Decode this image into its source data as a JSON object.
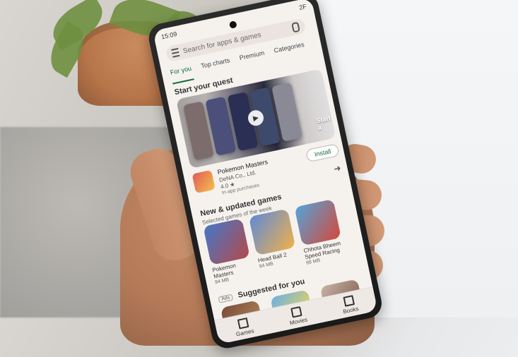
{
  "status": {
    "time": "15:09",
    "indicators": "2F"
  },
  "search": {
    "placeholder": "Search for apps & games"
  },
  "tabs": [
    "For you",
    "Top charts",
    "Premium",
    "Categories"
  ],
  "quest": {
    "title": "Start your quest",
    "right_label": "Start a"
  },
  "featured_app": {
    "name": "Pokemon Masters",
    "developer": "DeNA Co., Ltd.",
    "rating": "4.0 ★",
    "iap": "In-app purchases",
    "install": "Install"
  },
  "new_updated": {
    "title": "New & updated games",
    "subtitle": "Selected games of the week"
  },
  "games": [
    {
      "name": "Pokemon Masters",
      "size": "94 MB"
    },
    {
      "name": "Head Ball 2",
      "size": "94 MB"
    },
    {
      "name": "Chhota Bheem Speed Racing",
      "size": "88 MB"
    }
  ],
  "suggested": {
    "ads": "Ads",
    "title": "Suggested for you"
  },
  "bottom_nav": [
    "Games",
    "Movies",
    "Books"
  ],
  "icons": {
    "search": "search-icon",
    "menu": "menu-icon",
    "mic": "mic-icon",
    "play": "play-icon",
    "arrow": "arrow-right-icon",
    "games": "grid-icon",
    "movies": "movie-icon",
    "books": "book-icon"
  },
  "colors": {
    "accent": "#126b3e"
  }
}
